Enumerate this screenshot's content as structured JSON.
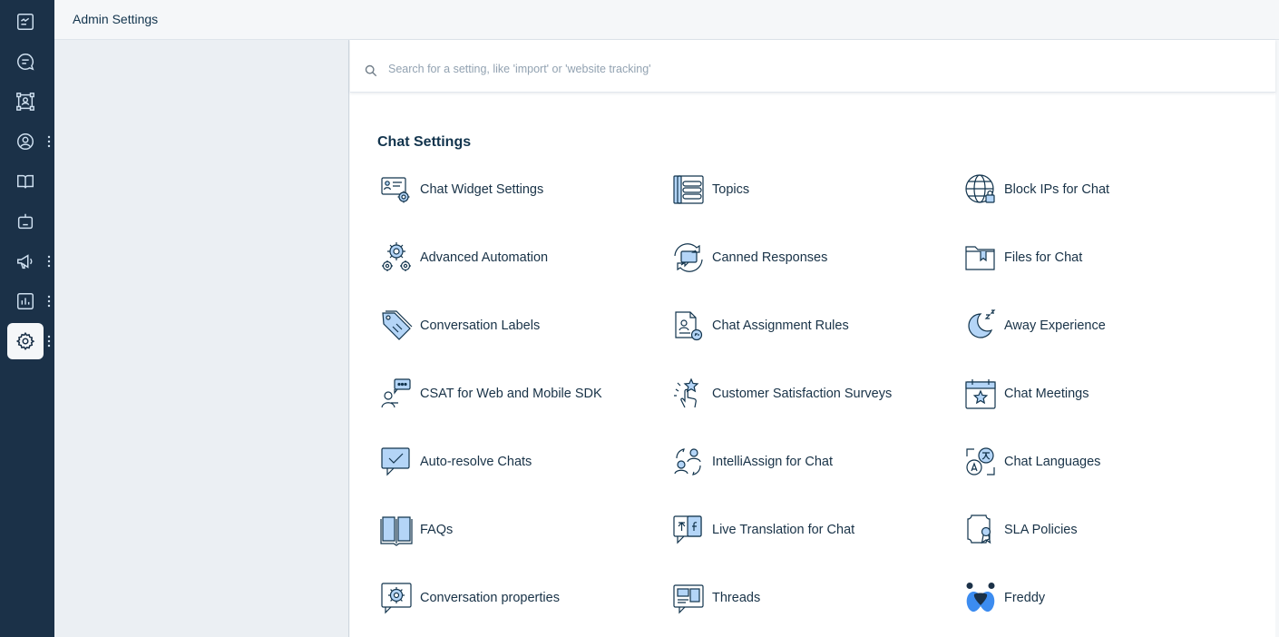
{
  "header": {
    "title": "Admin Settings"
  },
  "rail": {
    "items": [
      {
        "icon": "dashboard-icon",
        "has_menu": false,
        "active": false
      },
      {
        "icon": "conversations-icon",
        "has_menu": false,
        "active": false
      },
      {
        "icon": "contacts-network-icon",
        "has_menu": false,
        "active": false
      },
      {
        "icon": "user-profile-icon",
        "has_menu": true,
        "active": false
      },
      {
        "icon": "knowledge-book-icon",
        "has_menu": false,
        "active": false
      },
      {
        "icon": "bot-icon",
        "has_menu": false,
        "active": false
      },
      {
        "icon": "campaigns-megaphone-icon",
        "has_menu": true,
        "active": false
      },
      {
        "icon": "analytics-chart-icon",
        "has_menu": true,
        "active": false
      },
      {
        "icon": "settings-gear-icon",
        "has_menu": true,
        "active": true
      }
    ]
  },
  "search": {
    "placeholder": "Search for a setting, like 'import' or 'website tracking'",
    "value": ""
  },
  "section": {
    "title": "Chat Settings"
  },
  "settings": [
    {
      "label": "Chat Widget Settings",
      "icon": "chat-widget-settings-icon"
    },
    {
      "label": "Topics",
      "icon": "topics-icon"
    },
    {
      "label": "Block IPs for Chat",
      "icon": "block-ips-globe-icon"
    },
    {
      "label": "Advanced Automation",
      "icon": "automation-gears-icon"
    },
    {
      "label": "Canned Responses",
      "icon": "canned-responses-icon"
    },
    {
      "label": "Files for Chat",
      "icon": "files-folder-icon"
    },
    {
      "label": "Conversation Labels",
      "icon": "labels-tag-icon"
    },
    {
      "label": "Chat Assignment Rules",
      "icon": "assignment-rules-icon"
    },
    {
      "label": "Away Experience",
      "icon": "away-moon-icon"
    },
    {
      "label": "CSAT for Web and Mobile SDK",
      "icon": "csat-sdk-icon"
    },
    {
      "label": "Customer Satisfaction Surveys",
      "icon": "satisfaction-survey-icon"
    },
    {
      "label": "Chat Meetings",
      "icon": "meetings-calendar-icon"
    },
    {
      "label": "Auto-resolve Chats",
      "icon": "auto-resolve-icon"
    },
    {
      "label": "IntelliAssign for Chat",
      "icon": "intelliassign-icon"
    },
    {
      "label": "Chat Languages",
      "icon": "languages-icon"
    },
    {
      "label": "FAQs",
      "icon": "faqs-book-icon"
    },
    {
      "label": "Live Translation for Chat",
      "icon": "live-translation-icon"
    },
    {
      "label": "SLA Policies",
      "icon": "sla-policies-icon"
    },
    {
      "label": "Conversation properties",
      "icon": "conversation-properties-icon"
    },
    {
      "label": "Threads",
      "icon": "threads-icon"
    },
    {
      "label": "Freddy",
      "icon": "freddy-icon"
    }
  ],
  "colors": {
    "rail_bg": "#1b3148",
    "accent_fill": "#b4d5f7",
    "icon_stroke": "#12344d",
    "freddy_blue": "#3c8cf0"
  }
}
